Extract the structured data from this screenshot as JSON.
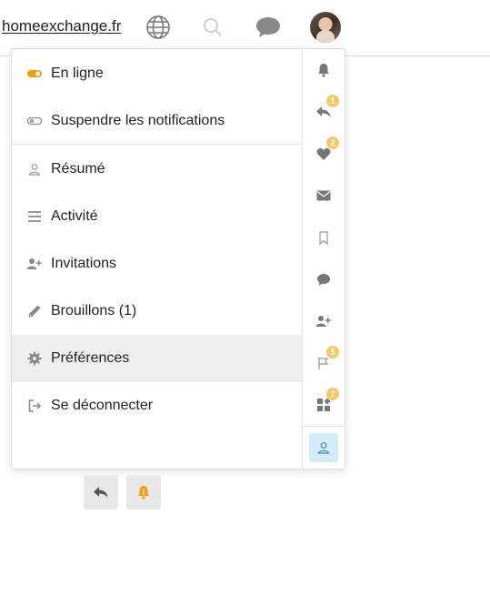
{
  "header": {
    "site_link": "homeexchange.fr",
    "icons": [
      "globe-icon",
      "search-icon",
      "chat-icon"
    ]
  },
  "menu": {
    "items": [
      {
        "label": "En ligne",
        "icon": "toggle-on-icon"
      },
      {
        "label": "Suspendre les notifications",
        "icon": "toggle-off-icon"
      },
      {
        "label": "Résumé",
        "icon": "user-icon"
      },
      {
        "label": "Activité",
        "icon": "list-icon"
      },
      {
        "label": "Invitations",
        "icon": "user-plus-icon"
      },
      {
        "label": "Brouillons (1)",
        "icon": "pencil-icon"
      },
      {
        "label": "Préférences",
        "icon": "gear-icon",
        "active": true
      },
      {
        "label": "Se déconnecter",
        "icon": "sign-out-icon"
      }
    ]
  },
  "quick_access": {
    "badges": {
      "replies": "1",
      "likes": "2",
      "flags": "5",
      "other": "7"
    }
  },
  "colors": {
    "accent": "#f39c12",
    "badge": "#f5c86b",
    "active_bg": "#eeeeee",
    "user_button_bg": "#d2ecf8"
  }
}
